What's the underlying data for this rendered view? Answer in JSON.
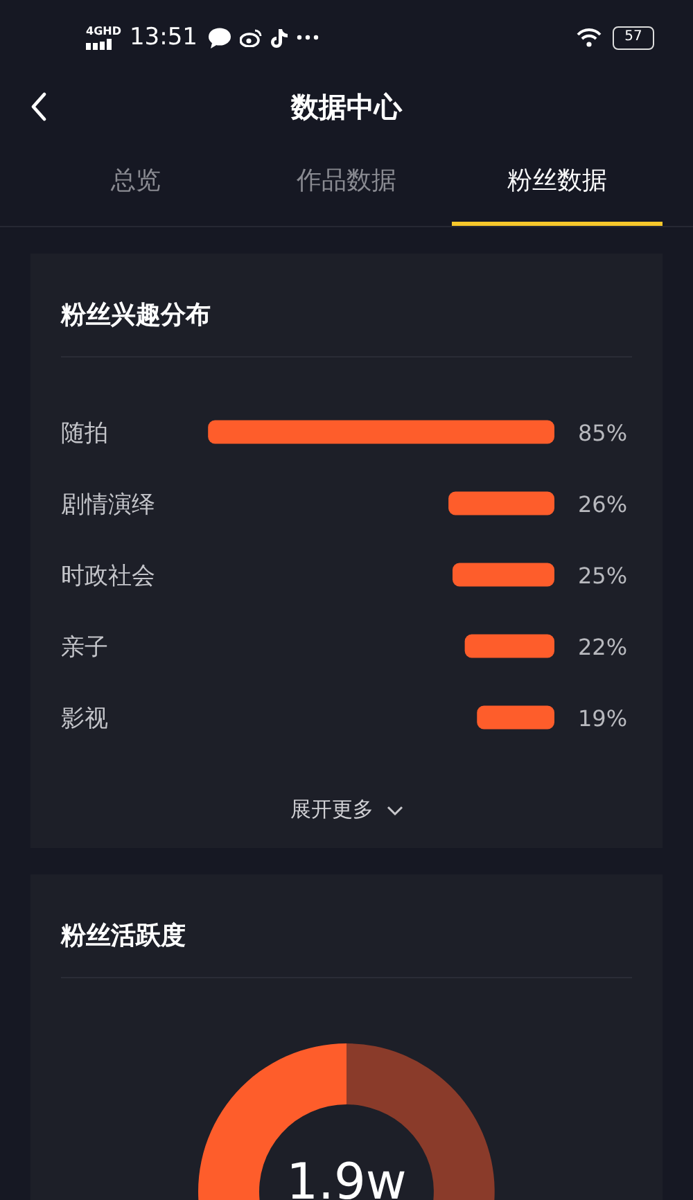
{
  "status_bar": {
    "network": "4GHD",
    "time": "13:51",
    "battery": "57"
  },
  "header": {
    "title": "数据中心"
  },
  "tabs": [
    {
      "label": "总览",
      "selected": false
    },
    {
      "label": "作品数据",
      "selected": false
    },
    {
      "label": "粉丝数据",
      "selected": true
    }
  ],
  "interest_card": {
    "title": "粉丝兴趣分布",
    "chart_data": {
      "type": "bar",
      "orientation": "horizontal",
      "categories": [
        "随拍",
        "剧情演绎",
        "时政社会",
        "亲子",
        "影视"
      ],
      "values": [
        85,
        26,
        25,
        22,
        19
      ],
      "data_labels": true,
      "value_labels": [
        "85%",
        "26%",
        "25%",
        "22%",
        "19%"
      ]
    },
    "expand_link": "展开更多"
  },
  "activity_card": {
    "title": "粉丝活跃度",
    "center_value": "1.9w"
  }
}
